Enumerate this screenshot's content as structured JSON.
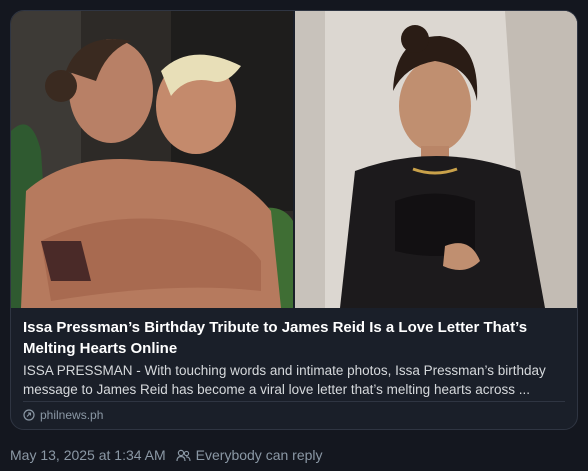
{
  "link_card": {
    "headline": "Issa Pressman’s Birthday Tribute to James Reid Is a Love Letter That’s Melting Hearts Online",
    "description": "ISSA PRESSMAN - With touching words and intimate photos, Issa Pressman’s birthday message to James Reid has become a viral love letter that’s melting hearts across ...",
    "source": "philnews.ph",
    "source_icon": "link-icon"
  },
  "post_meta": {
    "timestamp": "May 13, 2025 at 1:34 AM",
    "reply_setting": "Everybody can reply",
    "reply_icon": "people-icon"
  },
  "colors": {
    "background": "#14171f",
    "card_border": "#2f3542",
    "muted_text": "#8b98a5"
  }
}
